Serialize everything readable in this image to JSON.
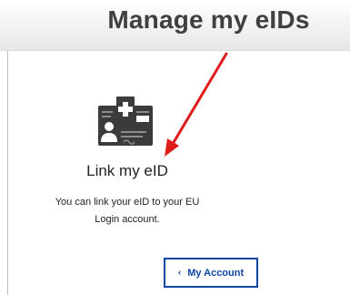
{
  "header": {
    "title": "Manage my eIDs"
  },
  "card": {
    "icon": "id-card-add-icon",
    "title": "Link my eID",
    "description_line1": "You can link your eID to your EU",
    "description_line2": "Login account."
  },
  "account_button": {
    "chevron": "‹",
    "label": "My Account"
  },
  "annotation": {
    "icon": "red-arrow-icon",
    "color": "#e01b1b"
  },
  "colors": {
    "accent": "#0e47a1",
    "icon": "#3b3b3b",
    "title_text": "#404040"
  }
}
